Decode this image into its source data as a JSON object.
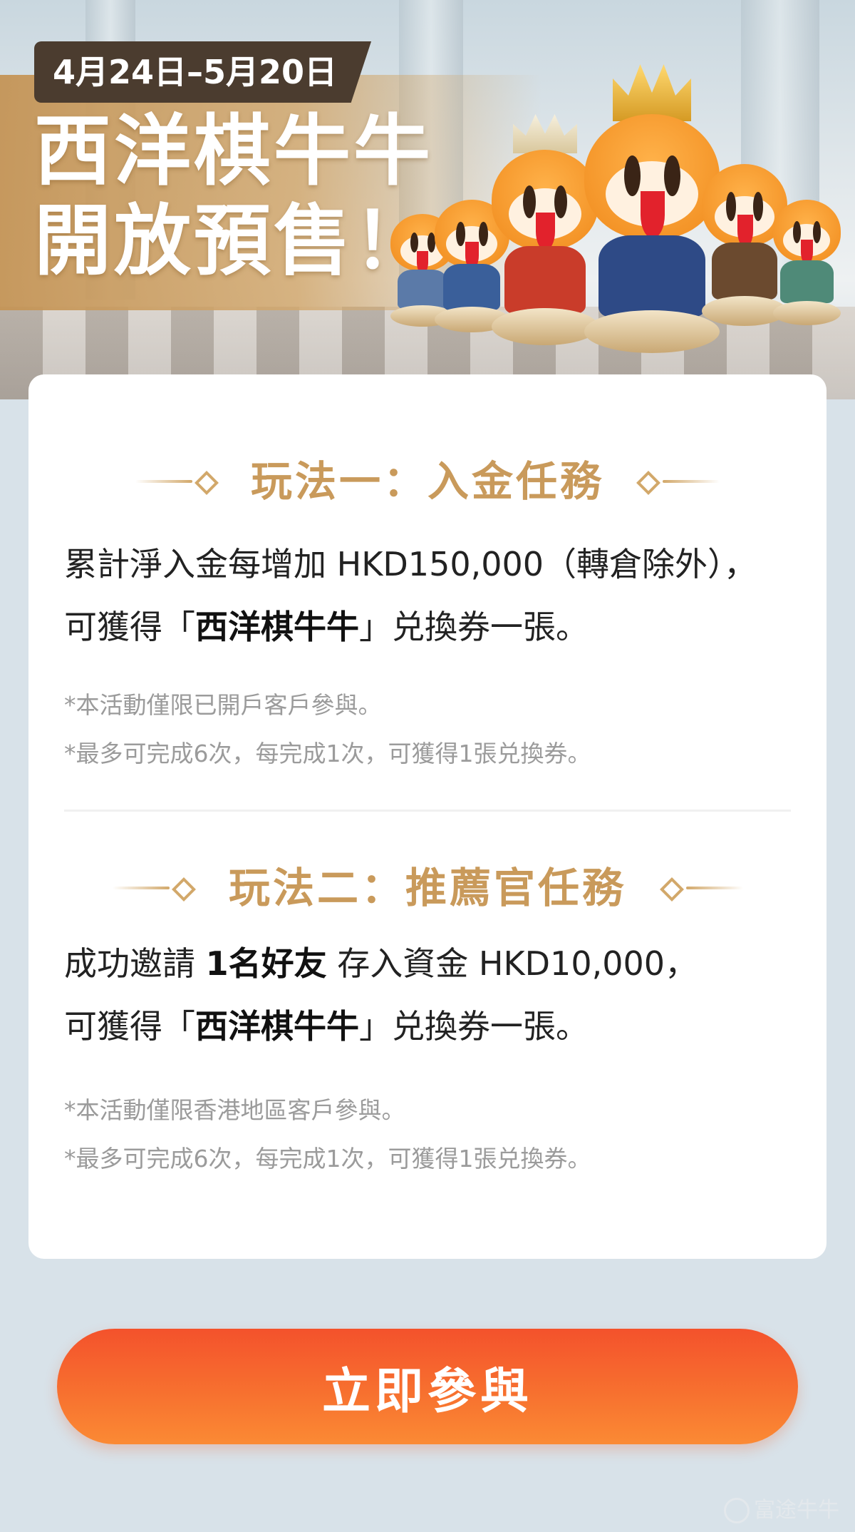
{
  "banner": {
    "date_range": "4月24日–5月20日",
    "title_line1": "西洋棋牛牛",
    "title_line2": "開放預售！"
  },
  "section1": {
    "title": "玩法一：入金任務",
    "desc_line1": "累計淨入金每增加 HKD150,000（轉倉除外），",
    "desc_line2_prefix": "可獲得「",
    "desc_line2_bold": "西洋棋牛牛",
    "desc_line2_suffix": "」兑換券一張。",
    "notes": [
      "*本活動僅限已開戶客戶參與。",
      "*最多可完成6次，每完成1次，可獲得1張兑換券。"
    ]
  },
  "section2": {
    "title": "玩法二：推薦官任務",
    "desc_line1_prefix": "成功邀請 ",
    "desc_line1_bold": "1名好友",
    "desc_line1_suffix": " 存入資金 HKD10,000，",
    "desc_line2_prefix": "可獲得「",
    "desc_line2_bold": "西洋棋牛牛",
    "desc_line2_suffix": "」兑換券一張。",
    "notes": [
      "*本活動僅限香港地區客戶參與。",
      "*最多可完成6次，每完成1次，可獲得1張兑換券。"
    ]
  },
  "cta": {
    "label": "立即參與"
  },
  "watermark": {
    "text": "富途牛牛"
  },
  "colors": {
    "accent_gold": "#c99a5b",
    "cta_orange": "#f4522c",
    "background": "#d8e2e9"
  }
}
